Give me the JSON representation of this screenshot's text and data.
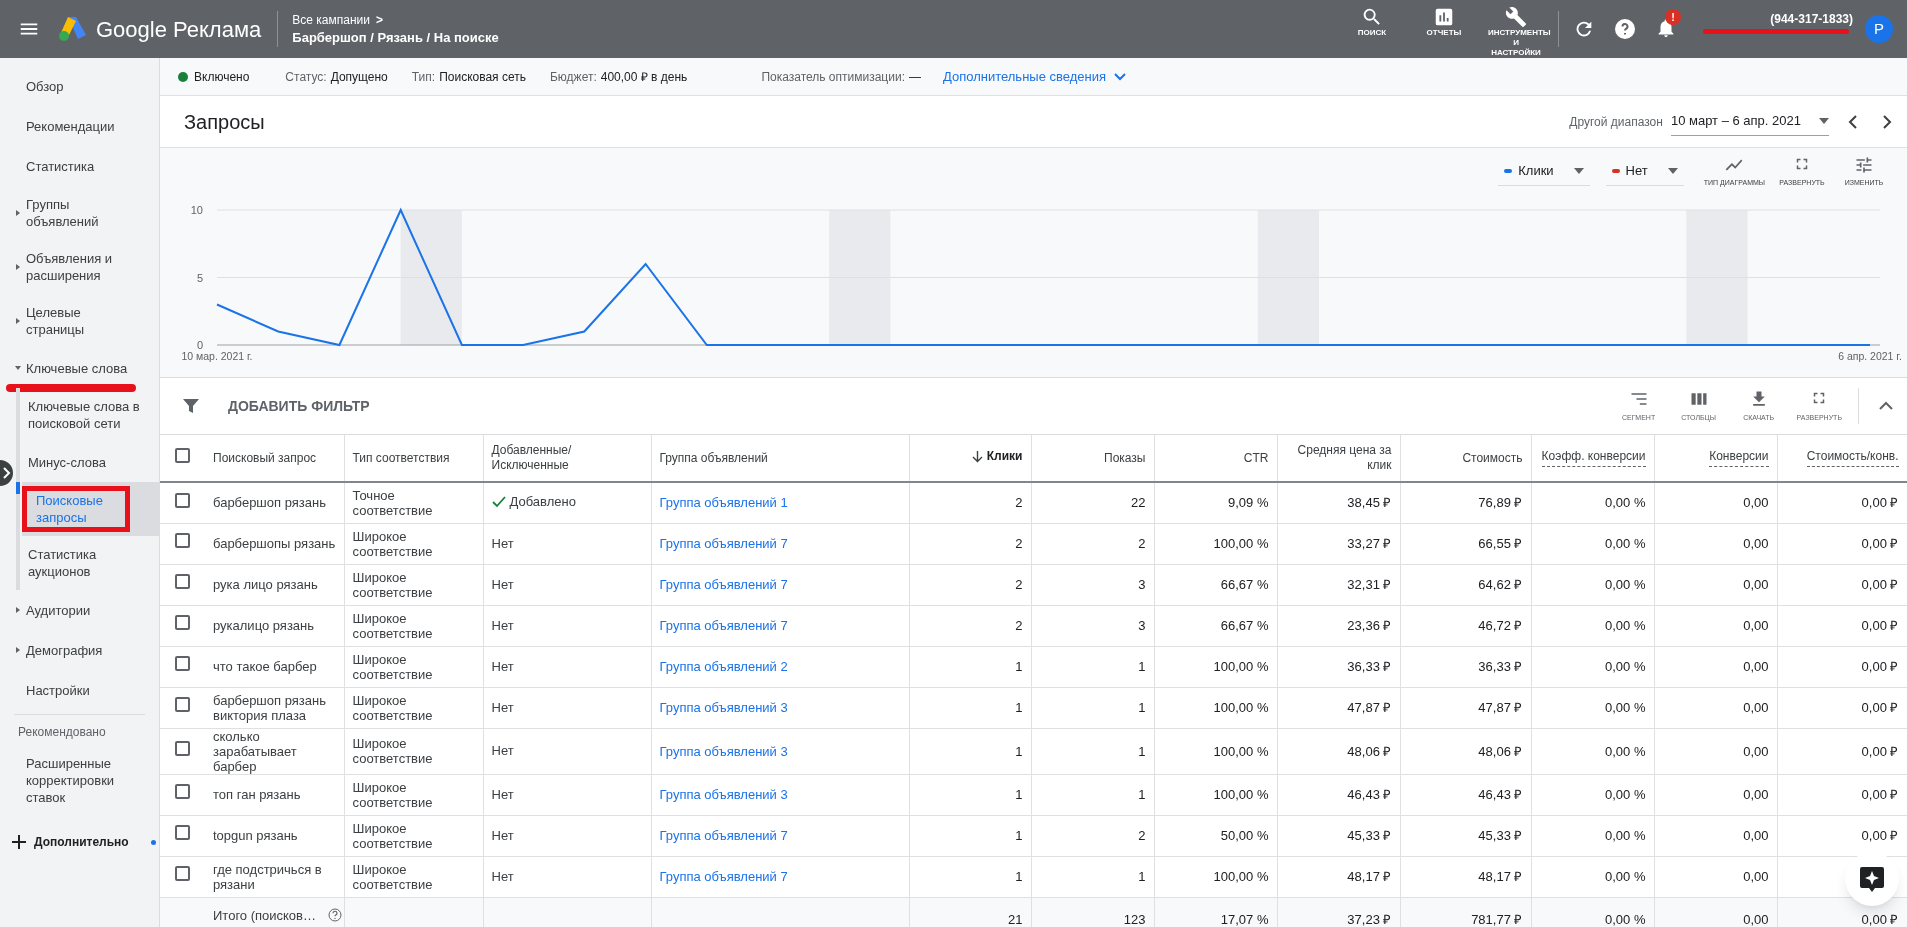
{
  "header": {
    "product": "Google Реклама",
    "breadcrumb_parent": "Все кампании",
    "breadcrumb_chevron": ">",
    "campaign": "Барбершоп / Рязань / На поиске",
    "tools": [
      {
        "kind": "search",
        "label": "ПОИСК"
      },
      {
        "kind": "reports",
        "label": "ОТЧЕТЫ"
      },
      {
        "kind": "tools",
        "label": "ИНСТРУМЕНТЫ И НАСТРОЙКИ"
      }
    ],
    "notification_badge": "!",
    "account_phone": "(944-317-1833)",
    "avatar_letter": "Р"
  },
  "sidebar": {
    "items": [
      {
        "label": "Обзор",
        "selected": false
      },
      {
        "label": "Рекомендации",
        "selected": false
      },
      {
        "label": "Статистика",
        "selected": false
      },
      {
        "label": "Группы объявлений",
        "selected": false,
        "expanded": false
      },
      {
        "label": "Объявления и расширения",
        "selected": false,
        "expanded": false
      },
      {
        "label": "Целевые страницы",
        "selected": false,
        "expanded": false
      },
      {
        "label": "Ключевые слова",
        "selected": false,
        "expanded": true,
        "children": [
          {
            "label": "Ключевые слова в поисковой сети",
            "selected": false
          },
          {
            "label": "Минус-слова",
            "selected": false
          },
          {
            "label": "Поисковые запросы",
            "selected": true
          },
          {
            "label": "Статистика аукционов",
            "selected": false
          }
        ]
      },
      {
        "label": "Аудитории",
        "selected": false,
        "expanded": false
      },
      {
        "label": "Демография",
        "selected": false,
        "expanded": false
      },
      {
        "label": "Настройки",
        "selected": false
      }
    ],
    "section_label": "Рекомендовано",
    "recommended": [
      {
        "label": "Расширенные корректировки ставок",
        "selected": false
      }
    ],
    "more": {
      "label": "Дополнительно",
      "new_dot": true
    }
  },
  "status_bar": {
    "state": "Включено",
    "enabled": true,
    "fields": [
      {
        "label": "Статус:",
        "value": "Допущено"
      },
      {
        "label": "Тип:",
        "value": "Поисковая сеть"
      },
      {
        "label": "Бюджет:",
        "value": "400,00 ₽ в день"
      },
      {
        "label": "Показатель оптимизации:",
        "value": "—"
      }
    ],
    "details_link": "Дополнительные сведения"
  },
  "page": {
    "title": "Запросы",
    "range_label": "Другой диапазон",
    "range_value": "10 март – 6 апр. 2021"
  },
  "chart": {
    "secondary_metric": {
      "label": "Нет",
      "color": "#d93025"
    },
    "tools": [
      {
        "kind": "chart_type",
        "label": "ТИП ДИАГРАММЫ"
      },
      {
        "kind": "expand",
        "label": "РАЗВЕРНУТЬ"
      },
      {
        "kind": "edit",
        "label": "ИЗМЕНИТЬ"
      }
    ],
    "chart_data": {
      "type": "line",
      "categories": [
        "10 мар. 2021 г.",
        null,
        null,
        null,
        null,
        null,
        null,
        null,
        null,
        null,
        null,
        null,
        null,
        null,
        null,
        null,
        null,
        null,
        null,
        null,
        null,
        null,
        null,
        null,
        null,
        null,
        null,
        "6 апр. 2021 г."
      ],
      "ylim": [
        0,
        10
      ],
      "yticks": [
        0,
        5,
        10
      ],
      "series": [
        {
          "name": "Клики",
          "color": "#1a73e8",
          "values": [
            3,
            1,
            0,
            10,
            0,
            0,
            1,
            6,
            0,
            0,
            0,
            0,
            0,
            0,
            0,
            0,
            0,
            0,
            0,
            0,
            0,
            0,
            0,
            0,
            0,
            0,
            0,
            0
          ]
        }
      ]
    }
  },
  "table_toolbar": {
    "filter_label": "ДОБАВИТЬ ФИЛЬТР",
    "tools": [
      {
        "kind": "segment",
        "label": "СЕГМЕНТ"
      },
      {
        "kind": "columns",
        "label": "СТОЛБЦЫ"
      },
      {
        "kind": "download",
        "label": "СКАЧАТЬ"
      },
      {
        "kind": "expand",
        "label": "РАЗВЕРНУТЬ"
      }
    ]
  },
  "table": {
    "select_all_checked": false,
    "columns": [
      {
        "label": "Поисковый запрос",
        "sorted": false,
        "dashed": false
      },
      {
        "label": "Тип соответствия",
        "sorted": false,
        "dashed": false
      },
      {
        "label": "Добавленные/ Исключенные",
        "sorted": false,
        "dashed": false
      },
      {
        "label": "Группа объявлений",
        "sorted": false,
        "dashed": false
      },
      {
        "label": "Клики",
        "sorted": true,
        "dashed": false
      },
      {
        "label": "Показы",
        "sorted": false,
        "dashed": false
      },
      {
        "label": "CTR",
        "sorted": false,
        "dashed": false
      },
      {
        "label": "Средняя цена за клик",
        "sorted": false,
        "dashed": false
      },
      {
        "label": "Стоимость",
        "sorted": false,
        "dashed": false
      },
      {
        "label": "Коэфф. конверсии",
        "sorted": false,
        "dashed": true
      },
      {
        "label": "Конверсии",
        "sorted": false,
        "dashed": true
      },
      {
        "label": "Стоимость/конв.",
        "sorted": false,
        "dashed": true
      }
    ],
    "rows": [
      {
        "checked": false,
        "query": "барбершоп рязань",
        "match_type": "Точное соответствие",
        "added": true,
        "status": "Добавлено",
        "ad_group": "Группа объявлений 1",
        "metrics": [
          "2",
          "22",
          "9,09 %",
          "38,45 ₽",
          "76,89 ₽",
          "0,00 %",
          "0,00",
          "0,00 ₽"
        ]
      },
      {
        "checked": false,
        "query": "барбершопы рязань",
        "match_type": "Широкое соответствие",
        "added": false,
        "status": "Нет",
        "ad_group": "Группа объявлений 7",
        "metrics": [
          "2",
          "2",
          "100,00 %",
          "33,27 ₽",
          "66,55 ₽",
          "0,00 %",
          "0,00",
          "0,00 ₽"
        ]
      },
      {
        "checked": false,
        "query": "рука лицо рязань",
        "match_type": "Широкое соответствие",
        "added": false,
        "status": "Нет",
        "ad_group": "Группа объявлений 7",
        "metrics": [
          "2",
          "3",
          "66,67 %",
          "32,31 ₽",
          "64,62 ₽",
          "0,00 %",
          "0,00",
          "0,00 ₽"
        ]
      },
      {
        "checked": false,
        "query": "рукалицо рязань",
        "match_type": "Широкое соответствие",
        "added": false,
        "status": "Нет",
        "ad_group": "Группа объявлений 7",
        "metrics": [
          "2",
          "3",
          "66,67 %",
          "23,36 ₽",
          "46,72 ₽",
          "0,00 %",
          "0,00",
          "0,00 ₽"
        ]
      },
      {
        "checked": false,
        "query": "что такое барбер",
        "match_type": "Широкое соответствие",
        "added": false,
        "status": "Нет",
        "ad_group": "Группа объявлений 2",
        "metrics": [
          "1",
          "1",
          "100,00 %",
          "36,33 ₽",
          "36,33 ₽",
          "0,00 %",
          "0,00",
          "0,00 ₽"
        ]
      },
      {
        "checked": false,
        "query": "барбершоп рязань виктория плаза",
        "match_type": "Широкое соответствие",
        "added": false,
        "status": "Нет",
        "ad_group": "Группа объявлений 3",
        "metrics": [
          "1",
          "1",
          "100,00 %",
          "47,87 ₽",
          "47,87 ₽",
          "0,00 %",
          "0,00",
          "0,00 ₽"
        ]
      },
      {
        "checked": false,
        "query": "сколько зарабатывает барбер",
        "match_type": "Широкое соответствие",
        "added": false,
        "status": "Нет",
        "ad_group": "Группа объявлений 3",
        "metrics": [
          "1",
          "1",
          "100,00 %",
          "48,06 ₽",
          "48,06 ₽",
          "0,00 %",
          "0,00",
          "0,00 ₽"
        ]
      },
      {
        "checked": false,
        "query": "топ ган рязань",
        "match_type": "Широкое соответствие",
        "added": false,
        "status": "Нет",
        "ad_group": "Группа объявлений 3",
        "metrics": [
          "1",
          "1",
          "100,00 %",
          "46,43 ₽",
          "46,43 ₽",
          "0,00 %",
          "0,00",
          "0,00 ₽"
        ]
      },
      {
        "checked": false,
        "query": "topgun рязань",
        "match_type": "Широкое соответствие",
        "added": false,
        "status": "Нет",
        "ad_group": "Группа объявлений 7",
        "metrics": [
          "1",
          "2",
          "50,00 %",
          "45,33 ₽",
          "45,33 ₽",
          "0,00 %",
          "0,00",
          "0,00 ₽"
        ]
      },
      {
        "checked": false,
        "query": "где подстричься в рязани",
        "match_type": "Широкое соответствие",
        "added": false,
        "status": "Нет",
        "ad_group": "Группа объявлений 7",
        "metrics": [
          "1",
          "1",
          "100,00 %",
          "48,17 ₽",
          "48,17 ₽",
          "0,00 %",
          "0,00"
        ]
      }
    ],
    "total": {
      "label": "Итого (поисков…",
      "metrics": [
        "21",
        "123",
        "17,07 %",
        "37,23 ₽",
        "781,77 ₽",
        "0,00 %",
        "0,00",
        "0,00 ₽"
      ]
    }
  }
}
